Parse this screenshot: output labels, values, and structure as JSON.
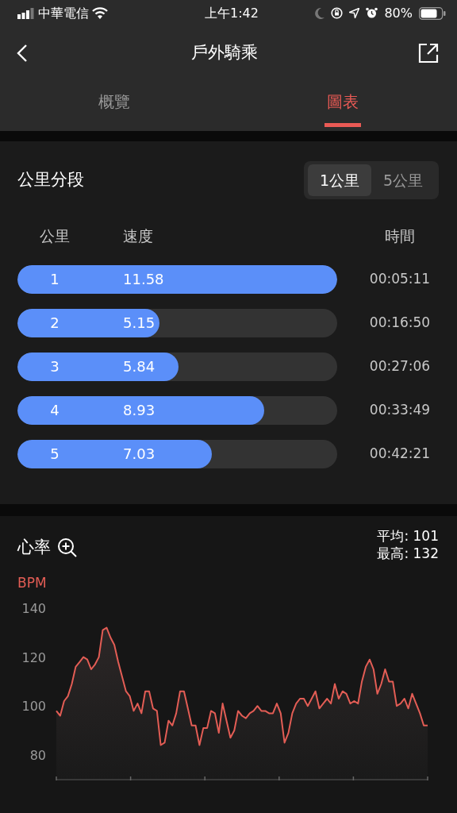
{
  "status_bar": {
    "carrier": "中華電信",
    "time": "上午1:42",
    "battery": "80%"
  },
  "nav": {
    "title": "戶外騎乘"
  },
  "tabs": [
    {
      "label": "概覽",
      "selected": false
    },
    {
      "label": "圖表",
      "selected": true
    }
  ],
  "splits": {
    "title": "公里分段",
    "units": [
      {
        "label": "1公里",
        "selected": true
      },
      {
        "label": "5公里",
        "selected": false
      }
    ],
    "columns": [
      "公里",
      "速度",
      "時間"
    ],
    "rows": [
      {
        "km": "1",
        "speed": "11.58",
        "time": "00:05:11",
        "level": 1.0
      },
      {
        "km": "2",
        "speed": "5.15",
        "time": "00:16:50",
        "level": 0.444
      },
      {
        "km": "3",
        "speed": "5.84",
        "time": "00:27:06",
        "level": 0.504
      },
      {
        "km": "4",
        "speed": "8.93",
        "time": "00:33:49",
        "level": 0.771
      },
      {
        "km": "5",
        "speed": "7.03",
        "time": "00:42:21",
        "level": 0.607
      }
    ]
  },
  "heart_rate": {
    "title": "心率",
    "average": "平均: 101",
    "max": "最高: 132",
    "chart_data": {
      "type": "area",
      "ylabel": "BPM",
      "ylim": [
        70,
        140
      ],
      "yticks": [
        80,
        100,
        120,
        140
      ],
      "series": [
        {
          "color": "#e35d55",
          "values": [
            98,
            96,
            102,
            104,
            109,
            116,
            118,
            120,
            119,
            115,
            117,
            120,
            131,
            132,
            128,
            125,
            118,
            112,
            106,
            104,
            98,
            101,
            97,
            106,
            106,
            99,
            98,
            84,
            85,
            94,
            92,
            97,
            106,
            106,
            99,
            92,
            92,
            84,
            91,
            91,
            98,
            97,
            89,
            101,
            94,
            87,
            90,
            98,
            96,
            95,
            97,
            98,
            100,
            98,
            98,
            97,
            97,
            101,
            97,
            85,
            89,
            97,
            101,
            103,
            103,
            100,
            103,
            106,
            99,
            101,
            103,
            101,
            109,
            103,
            106,
            105,
            101,
            102,
            101,
            110,
            116,
            119,
            115,
            105,
            109,
            115,
            110,
            110,
            100,
            101,
            103,
            99,
            105,
            101,
            97,
            92,
            92
          ]
        }
      ]
    }
  }
}
